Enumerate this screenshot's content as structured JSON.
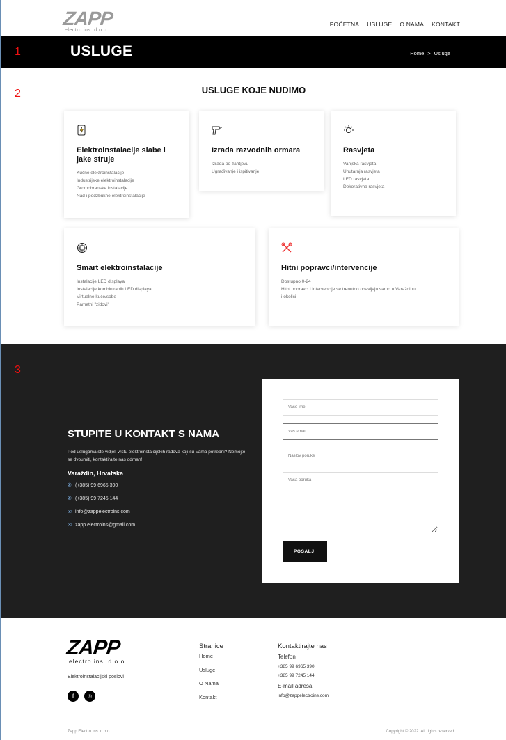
{
  "brand": {
    "logo_text": "ZAPP",
    "logo_subtitle": "electro ins. d.o.o."
  },
  "nav": [
    "POČETNA",
    "USLUGE",
    "O NAMA",
    "KONTAKT"
  ],
  "banner": {
    "title": "USLUGE",
    "crumb_home": "Home",
    "crumb_sep": ">",
    "crumb_current": "Usluge"
  },
  "markers": [
    "1",
    "2",
    "3"
  ],
  "services": {
    "title": "USLUGE KOJE NUDIMO",
    "cards": [
      {
        "icon": "battery-icon",
        "title": "Elektroinstalacije slabe i jake struje",
        "lines": [
          "Kućne elektroinstalacije",
          "Industrijske elektroinstalacije",
          "Gromobranske instalacije",
          "Nad i podžbukne elektroinstalacije"
        ]
      },
      {
        "icon": "drill-icon",
        "title": "Izrada razvodnih ormara",
        "lines": [
          "Izrada po zahtjevu",
          "Ugrađivanje i ispitivanje"
        ]
      },
      {
        "icon": "lightbulb-icon",
        "title": "Rasvjeta",
        "lines": [
          "Vanjska rasvjeta",
          "Unutarnja rasvjeta",
          "LED rasvjeta",
          "Dekorativna rasvjeta"
        ]
      },
      {
        "icon": "smart-chip-icon",
        "title": "Smart elektroinstalacije",
        "lines": [
          "Instalacije LED displaya",
          "Instalacije kombiniranih LED displaya",
          "Virtualne kuće/sobe",
          "Pametni \"zidovi\""
        ]
      },
      {
        "icon": "tools-icon",
        "title": "Hitni popravci/intervencije",
        "lines": [
          "Dostupno 0-24",
          "Hitni popravci i intervencije se trenutno obavljaju samo u Varaždinu",
          "i okolici"
        ]
      }
    ]
  },
  "contact": {
    "title": "STUPITE U KONTAKT S NAMA",
    "text": "Pod uslugama ste vidjeli vrstu elektroinstalcijskih radova koji su Vama potrebni? Nemojte se dvoumiti, kontaktirajte nas odmah!",
    "city": "Varaždin, Hrvatska",
    "phones": [
      "(+385) 99 6965 390",
      "(+385) 99 7245 144"
    ],
    "emails": [
      "info@zappelectroins.com",
      "zapp.electroins@gmail.com"
    ],
    "form": {
      "name_placeholder": "Vaše ime",
      "email_placeholder": "Vaš email",
      "subject_placeholder": "Naslov poruke",
      "message_placeholder": "Vaša poruka",
      "send_label": "POŠALJI"
    }
  },
  "footer": {
    "logo_text": "ZAPP",
    "logo_subtitle": "electro ins. d.o.o.",
    "description": "Elektroinstalacijski poslovi",
    "social": [
      "f",
      "◎"
    ],
    "pages_title": "Stranice",
    "pages": [
      "Home",
      "Usluge",
      "O Nama",
      "Kontakt"
    ],
    "contact_title": "Kontaktirajte nas",
    "phone_label": "Telefon",
    "phones": [
      "+385 99 6965 390",
      "+385 99 7245 144"
    ],
    "email_label": "E-mail adresa",
    "email": "info@zappelectroins.com",
    "copyright_left": "Zapp Electro Ins. d.o.o.",
    "copyright_right": "Copyright © 2022. All rights reserved."
  },
  "colors": {
    "accent": "#000000",
    "dark_bg": "#1f1f1f",
    "marker": "#ee1111",
    "icon_link": "#7fb2e5"
  }
}
